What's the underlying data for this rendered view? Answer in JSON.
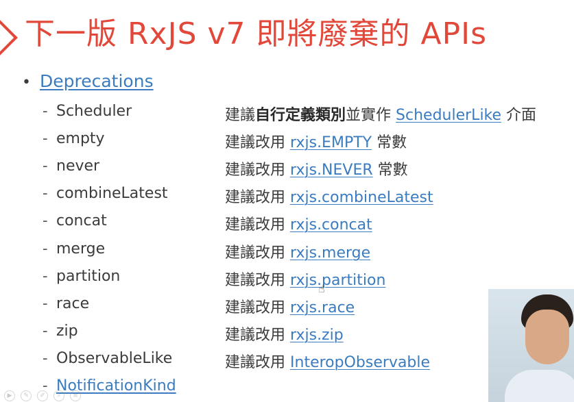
{
  "slide": {
    "title": "下一版 RxJS v7 即將廢棄的 APIs",
    "bullet": "•",
    "bullet_label": "Deprecations"
  },
  "rows": [
    {
      "name": "Scheduler",
      "prefix": "建議",
      "bold": "自行定義類別",
      "mid": "並實作",
      "link": "SchedulerLike",
      "suffix": "介面"
    },
    {
      "name": "empty",
      "prefix": "建議改用",
      "link": "rxjs.EMPTY",
      "suffix": "常數"
    },
    {
      "name": "never",
      "prefix": "建議改用",
      "link": "rxjs.NEVER",
      "suffix": "常數"
    },
    {
      "name": "combineLatest",
      "prefix": "建議改用",
      "link": "rxjs.combineLatest"
    },
    {
      "name": "concat",
      "prefix": "建議改用",
      "link": "rxjs.concat"
    },
    {
      "name": "merge",
      "prefix": "建議改用",
      "link": "rxjs.merge"
    },
    {
      "name": "partition",
      "prefix": "建議改用",
      "link": "rxjs.partition"
    },
    {
      "name": "race",
      "prefix": "建議改用",
      "link": "rxjs.race"
    },
    {
      "name": "zip",
      "prefix": "建議改用",
      "link": "rxjs.zip"
    },
    {
      "name": "ObservableLike",
      "prefix": "建議改用",
      "link": "InteropObservable"
    },
    {
      "name": "NotificationKind"
    }
  ],
  "dash": "-",
  "icons": {
    "cursor": "hand-pointer-icon",
    "toolbar": [
      "play-icon",
      "edit-icon",
      "pen-icon",
      "search-icon",
      "menu-icon"
    ]
  },
  "colors": {
    "title": "#e2483a",
    "link": "#3a7cbf",
    "text": "#3b3b3b"
  }
}
